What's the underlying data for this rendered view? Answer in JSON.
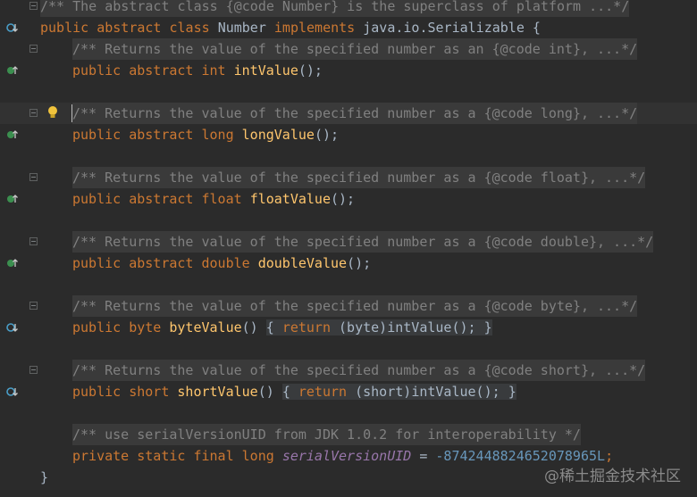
{
  "editor": {
    "lines": {
      "l0": {
        "comment": "/** The abstract class {@code Number} is the superclass of platform ...*/"
      },
      "l1": {
        "kw1": "public",
        "kw2": "abstract",
        "kw3": "class",
        "name": "Number",
        "kw4": "implements",
        "type": "java.io.Serializable",
        "brace": "{"
      },
      "l2": {
        "comment": "/** Returns the value of the specified number as an {@code int}, ...*/"
      },
      "l3": {
        "kw1": "public",
        "kw2": "abstract",
        "type": "int",
        "method": "intValue",
        "rest": "();"
      },
      "l5": {
        "comment": "/** Returns the value of the specified number as a {@code long}, ...*/"
      },
      "l6": {
        "kw1": "public",
        "kw2": "abstract",
        "type": "long",
        "method": "longValue",
        "rest": "();"
      },
      "l8": {
        "comment": "/** Returns the value of the specified number as a {@code float}, ...*/"
      },
      "l9": {
        "kw1": "public",
        "kw2": "abstract",
        "type": "float",
        "method": "floatValue",
        "rest": "();"
      },
      "l11": {
        "comment": "/** Returns the value of the specified number as a {@code double}, ...*/"
      },
      "l12": {
        "kw1": "public",
        "kw2": "abstract",
        "type": "double",
        "method": "doubleValue",
        "rest": "();"
      },
      "l14": {
        "comment": "/** Returns the value of the specified number as a {@code byte}, ...*/"
      },
      "l15": {
        "kw1": "public",
        "type": "byte",
        "method": "byteValue",
        "parens": "()",
        "open": "{",
        "ret": "return",
        "cast": "(byte)",
        "call": "intValue();",
        "close": "}"
      },
      "l17": {
        "comment": "/** Returns the value of the specified number as a {@code short}, ...*/"
      },
      "l18": {
        "kw1": "public",
        "type": "short",
        "method": "shortValue",
        "parens": "()",
        "open": "{",
        "ret": "return",
        "cast": "(short)",
        "call": "intValue();",
        "close": "}"
      },
      "l20": {
        "comment": "/** use serialVersionUID from JDK 1.0.2 for interoperability */"
      },
      "l21": {
        "kw1": "private",
        "kw2": "static",
        "kw3": "final",
        "type": "long",
        "field": "serialVersionUID",
        "eq": "=",
        "value": "-8742448824652078965L",
        "semi": ";"
      },
      "l22": {
        "brace": "}"
      }
    }
  },
  "watermark": "@稀土掘金技术社区",
  "icons": {
    "overrides": "implemented-down-arrow-icon",
    "implemented": "override-green-icon",
    "bulb": "lightbulb-icon"
  },
  "colors": {
    "background": "#2B2B2B",
    "keyword": "#CC7832",
    "method": "#FFC66D",
    "comment": "#808080",
    "number": "#6897BB",
    "field": "#9876AA"
  }
}
